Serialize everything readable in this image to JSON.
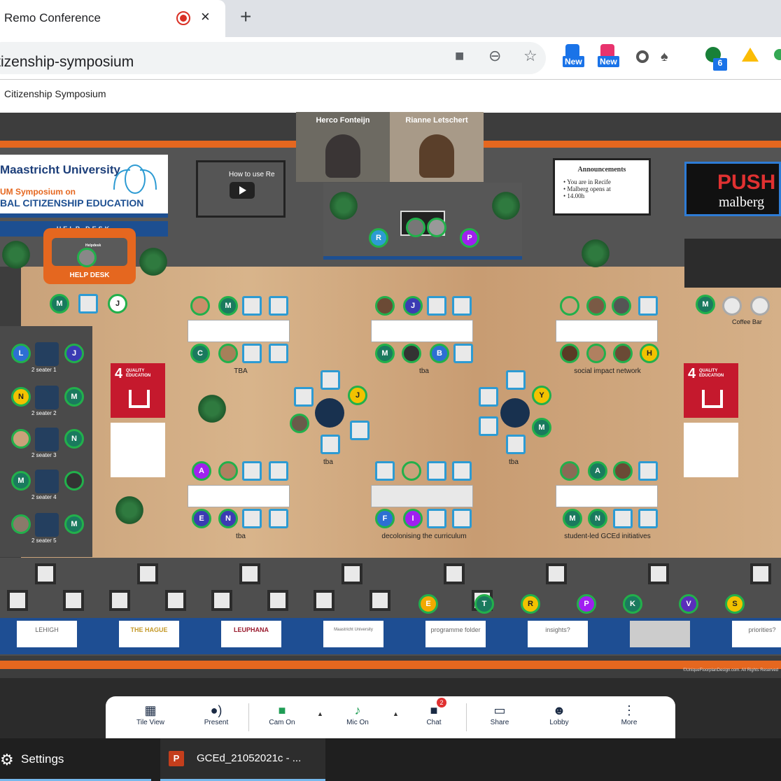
{
  "browser": {
    "tab_title": "Remo Conference",
    "tab_close": "×",
    "new_tab": "+",
    "url": "citizenship-symposium",
    "ext_badge_1": "New",
    "ext_badge_2": "New",
    "ext_badge_3": "6"
  },
  "remo": {
    "event_title": "Citizenship Symposium",
    "video_tiles": [
      {
        "name": "Herco Fonteijn"
      },
      {
        "name": "Rianne Letschert"
      }
    ],
    "signs": {
      "um_name": "Maastricht University",
      "um_line1": "UM Symposium on",
      "um_line2": "BAL CITIZENSHIP EDUCATION",
      "help_banner": "HELP DESK",
      "helpdesk_small": "Helpdesk",
      "helpdesk_label": "HELP DESK",
      "video_title": "How to use Re",
      "announce_title": "Announcements",
      "announce_items": [
        "You are in Recife",
        "Malberg opens at",
        "14.00h"
      ],
      "push_title": "PUSH",
      "push_sub": "malberg",
      "coffee_bar": "Coffee Bar",
      "sdg_number": "4",
      "sdg_text": "QUALITY EDUCATION",
      "copyright": "©UniqueFloorplanDesign.com. All Rights Reserved"
    },
    "tables": [
      {
        "label": "TBA"
      },
      {
        "label": "tba"
      },
      {
        "label": "social impact network"
      },
      {
        "label": "tba"
      },
      {
        "label": "decolonising the curriculum"
      },
      {
        "label": "student-led GCEd initiatives"
      }
    ],
    "round_tables": [
      {
        "label": "tba"
      },
      {
        "label": "tba"
      }
    ],
    "two_seaters": [
      "2 seater 1",
      "2 seater 2",
      "2 seater 3",
      "2 seater 4",
      "2 seater 5"
    ],
    "avatars": {
      "stage_r": "R",
      "stage_p": "P",
      "helpdesk_m": "M",
      "helpdesk_j": "J",
      "t1_m": "M",
      "t1_c": "C",
      "t2_j": "J",
      "t2_m": "M",
      "t2_b": "B",
      "t3_h": "H",
      "bar_m": "M",
      "r1_j": "J",
      "r2_y": "Y",
      "r2_m": "M",
      "t4_a": "A",
      "t4_e": "E",
      "t4_n": "N",
      "t5_f": "F",
      "t5_i": "I",
      "t6_a": "A",
      "t6_m": "M",
      "t6_n": "N",
      "s1_l": "L",
      "s1_j": "J",
      "s2_n": "N",
      "s2_m": "M",
      "s3_n": "N",
      "s4_m": "M",
      "s5_m": "M",
      "row_e": "E",
      "row_t": "T",
      "row_r": "R",
      "row_p": "P",
      "row_k": "K",
      "row_v": "V",
      "row_s": "S"
    },
    "sponsors": [
      "LEHIGH",
      "THE HAGUE",
      "LEUPHANA",
      "Maastricht University",
      "programme folder",
      "insights?",
      "",
      "priorities?"
    ]
  },
  "toolbar": {
    "tile_view": "Tile View",
    "present": "Present",
    "cam_on": "Cam On",
    "mic_on": "Mic On",
    "chat": "Chat",
    "chat_badge": "2",
    "share": "Share",
    "lobby": "Lobby",
    "more": "More"
  },
  "taskbar": {
    "settings": "Settings",
    "ppt": "GCEd_21052021c - ..."
  },
  "colors": {
    "accent_orange": "#e5671f",
    "um_blue": "#1d4f91",
    "avatar_ring": "#22b04b",
    "sdg_red": "#c5192d"
  }
}
